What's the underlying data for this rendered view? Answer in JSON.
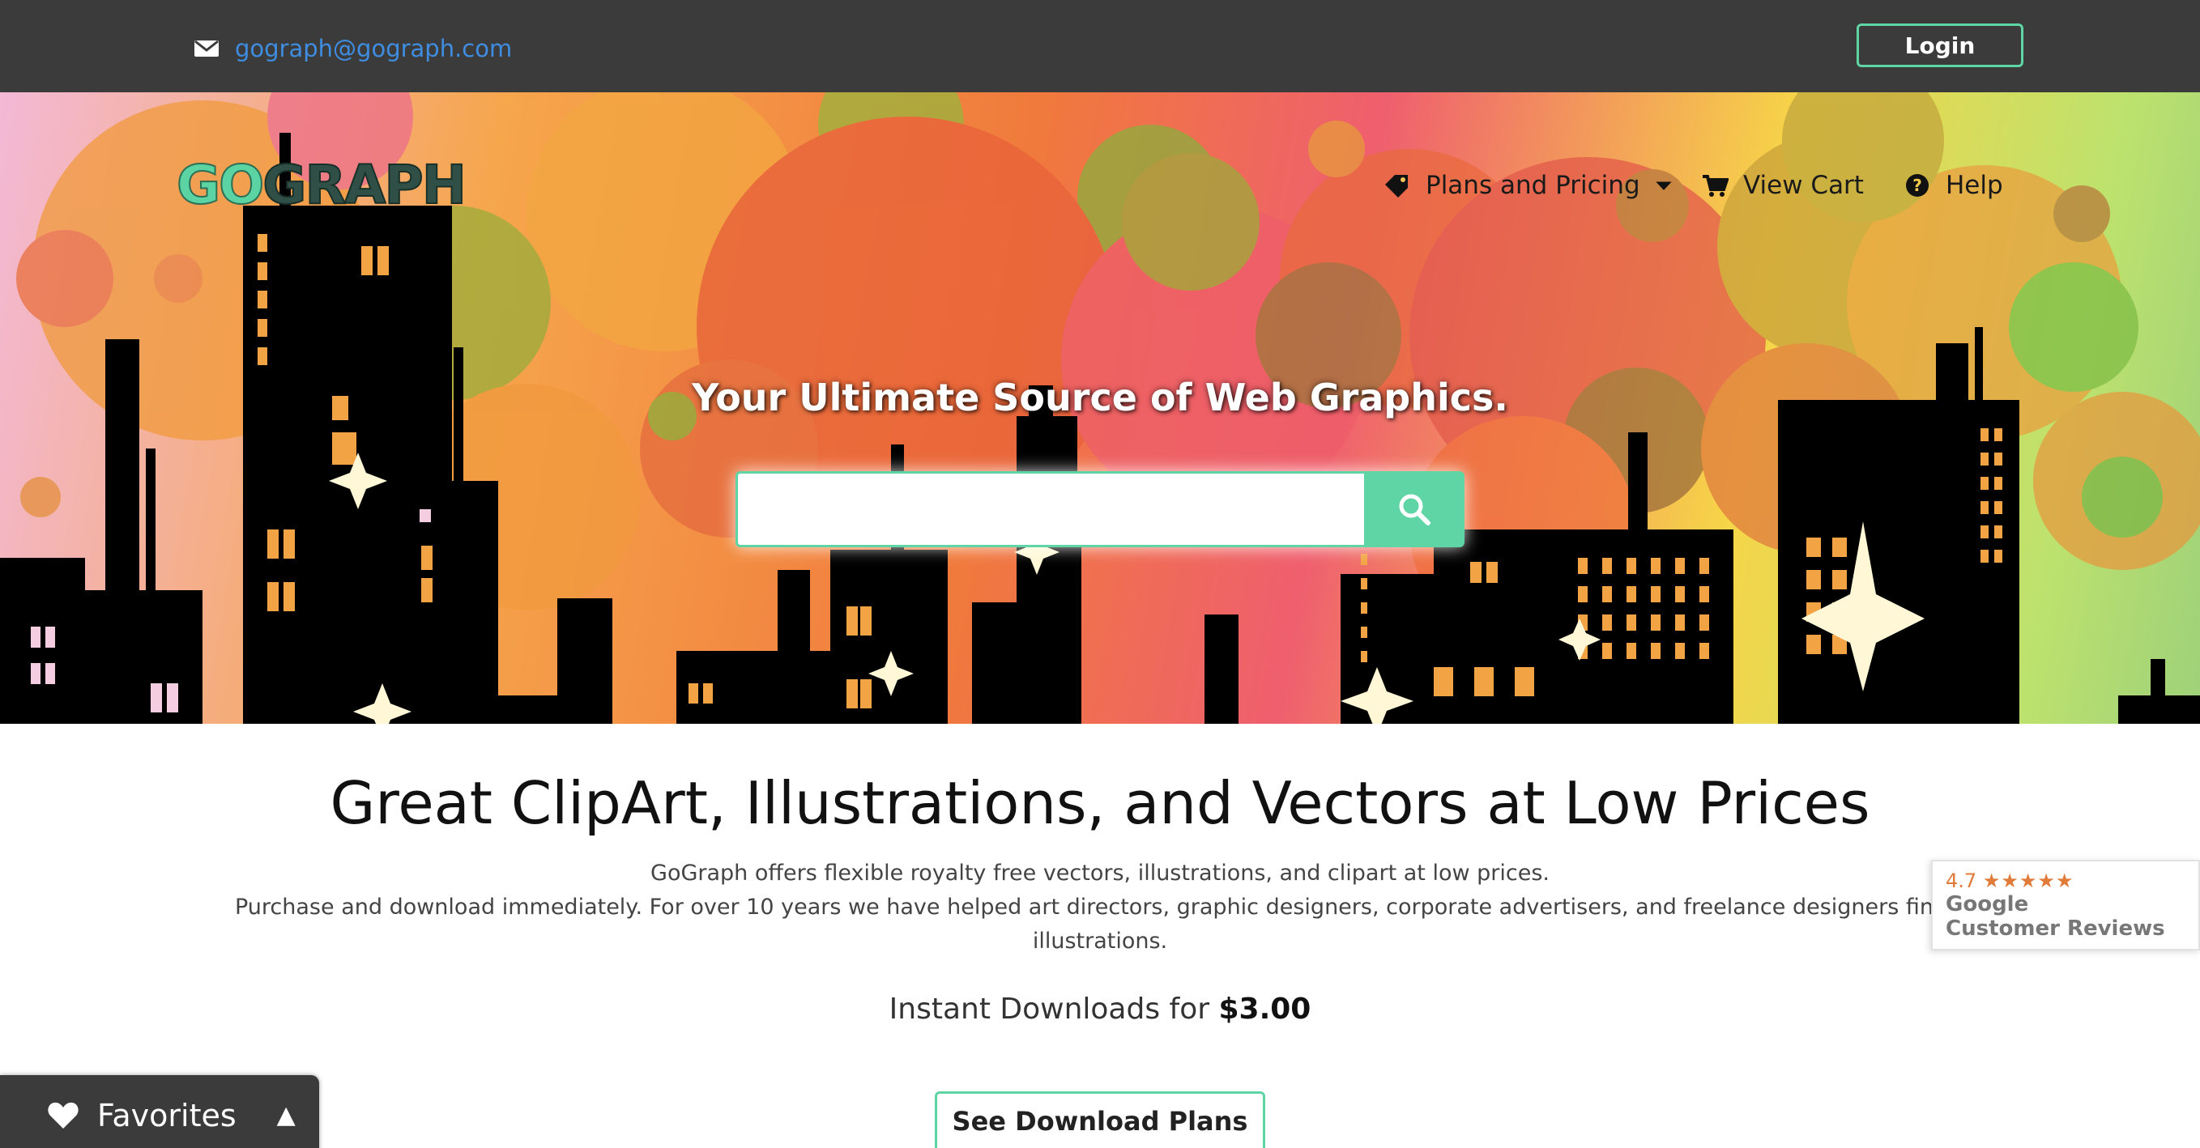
{
  "topbar": {
    "email": "gograph@gograph.com",
    "login_label": "Login",
    "email_icon": "envelope-icon"
  },
  "hero": {
    "logo_part1": "GO",
    "logo_part2": "GRAPH",
    "nav": [
      {
        "label": "Plans and Pricing",
        "icon": "tag-icon",
        "dropdown": true
      },
      {
        "label": "View Cart",
        "icon": "cart-icon"
      },
      {
        "label": "Help",
        "icon": "help-icon"
      }
    ],
    "tagline": "Your Ultimate Source of Web Graphics.",
    "search": {
      "value": "",
      "placeholder": ""
    }
  },
  "content": {
    "headline": "Great ClipArt, Illustrations, and Vectors at Low Prices",
    "desc_line1": "GoGraph offers flexible royalty free vectors, illustrations, and clipart at low prices.",
    "desc_line2": "Purchase and download immediately. For over 10 years we have helped art directors, graphic designers, corporate advertisers, and freelance designers find high-quality",
    "desc_line3": "illustrations.",
    "price_prefix": "Instant Downloads for",
    "price_value": "$3.00",
    "plans_button": "See Download Plans"
  },
  "reviews": {
    "rating": "4.7",
    "stars": "★★★★★",
    "line1": "Google",
    "line2": "Customer Reviews"
  },
  "favorites": {
    "label": "Favorites",
    "arrow": "▲"
  },
  "colors": {
    "topbar_bg": "#3b3b3b",
    "accent": "#5fd4a4",
    "link": "#3f8de0"
  }
}
